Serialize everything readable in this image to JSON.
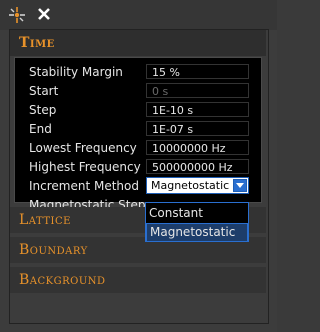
{
  "toolbar": {
    "pin_icon": "pin-icon",
    "close_icon": "close-icon"
  },
  "sections": {
    "time": "Time",
    "lattice": "Lattice",
    "boundary": "Boundary",
    "background": "Background"
  },
  "time": {
    "rows": [
      {
        "label": "Stability Margin",
        "value": "15 %"
      },
      {
        "label": "Start",
        "value": "0 s"
      },
      {
        "label": "Step",
        "value": "1E-10 s"
      },
      {
        "label": "End",
        "value": "1E-07 s"
      },
      {
        "label": "Lowest Frequency",
        "value": "10000000 Hz"
      },
      {
        "label": "Highest Frequency",
        "value": "500000000 Hz"
      },
      {
        "label": "Increment Method",
        "value": "Magnetostatic"
      },
      {
        "label": "Magnetostatic Steps",
        "value": ""
      }
    ],
    "dropdown_options": [
      "Constant",
      "Magnetostatic"
    ],
    "selected_option": "Magnetostatic"
  },
  "colors": {
    "accent": "#e8922a",
    "selection": "#2a6fd0"
  }
}
